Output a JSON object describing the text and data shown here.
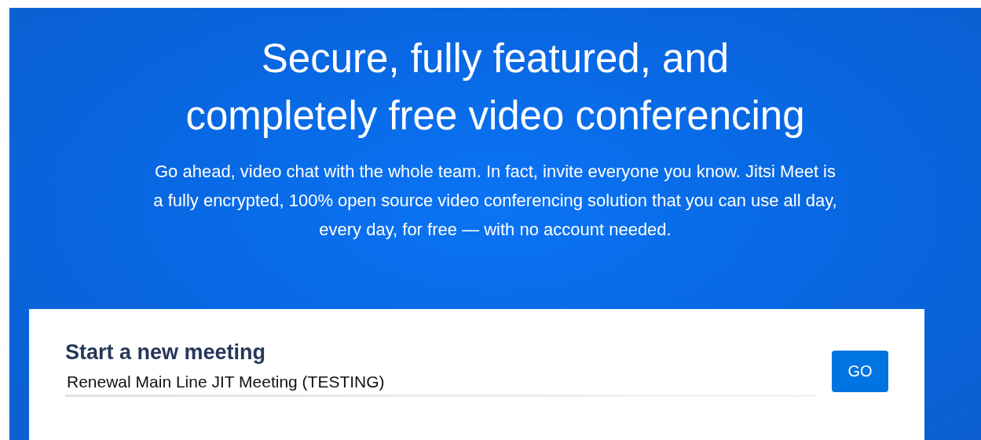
{
  "hero": {
    "title": "Secure, fully featured, and\ncompletely free video conferencing",
    "description": "Go ahead, video chat with the whole team. In fact, invite everyone you know. Jitsi Meet is\na fully encrypted, 100% open source video conferencing solution that you can use all day,\nevery day, for free — with no account needed."
  },
  "meeting_card": {
    "heading": "Start a new meeting",
    "room_name": {
      "value": "Renewal Main Line JIT Meeting (TESTING)"
    },
    "button": "GO"
  }
}
